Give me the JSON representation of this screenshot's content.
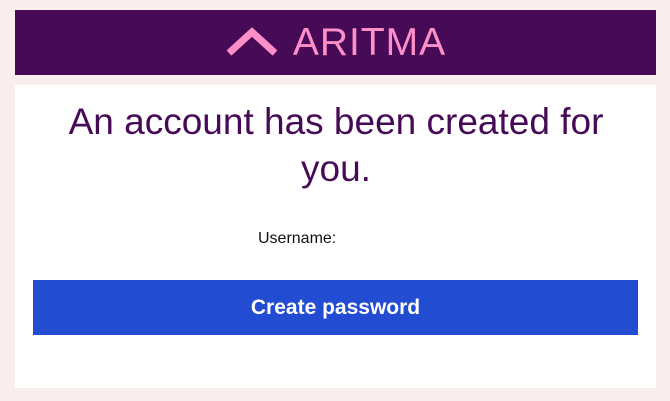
{
  "brand": {
    "name": "ARITMA",
    "logo_icon": "chevron-up-icon",
    "header_color": "#470a57",
    "logo_color": "#ff8fc8"
  },
  "message": {
    "headline": "An account has been created for you."
  },
  "account": {
    "username_label": "Username:",
    "username_value": ""
  },
  "actions": {
    "create_password_label": "Create password",
    "button_color": "#224dd2"
  },
  "colors": {
    "page_background": "#f9eeee",
    "card_background": "#ffffff",
    "headline_text": "#470a57"
  }
}
